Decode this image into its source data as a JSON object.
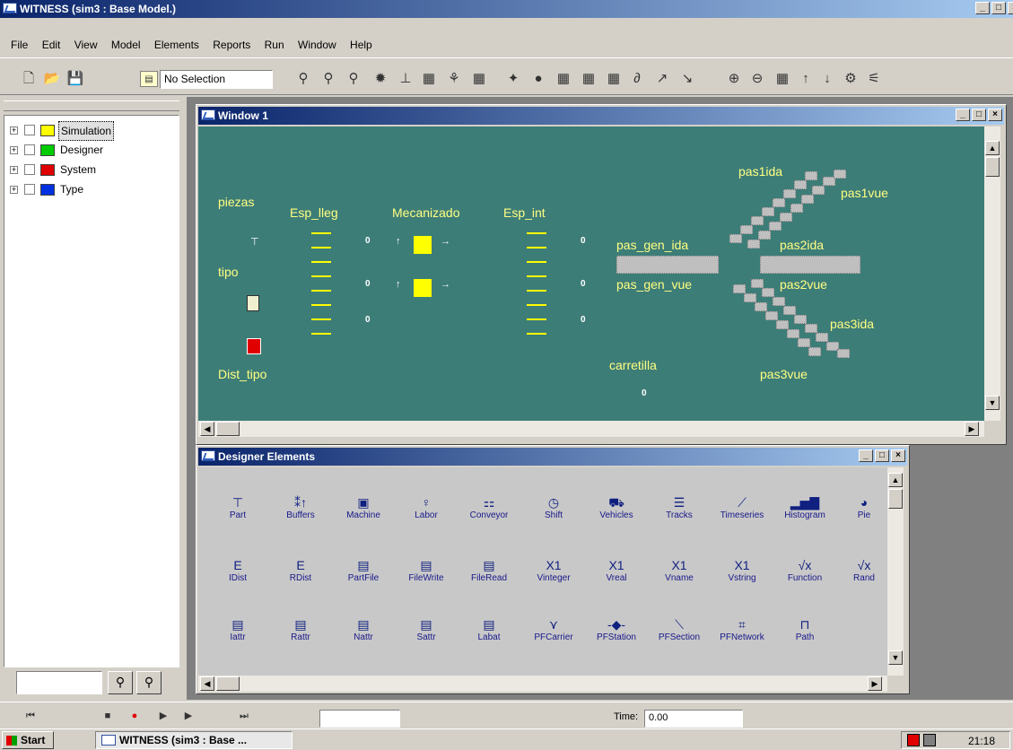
{
  "app": {
    "title": "WITNESS (sim3 : Base Model.)"
  },
  "menu": [
    "File",
    "Edit",
    "View",
    "Model",
    "Elements",
    "Reports",
    "Run",
    "Window",
    "Help"
  ],
  "toolbar": {
    "selection": "No Selection"
  },
  "tree": {
    "items": [
      {
        "label": "Simulation",
        "color": "#ffff00"
      },
      {
        "label": "Designer",
        "color": "#00cc00"
      },
      {
        "label": "System",
        "color": "#e00000"
      },
      {
        "label": "Type",
        "color": "#0030e0"
      }
    ]
  },
  "window1": {
    "title": "Window 1",
    "labels": {
      "piezas": "piezas",
      "tipo": "tipo",
      "dist_tipo": "Dist_tipo",
      "esp_lleg": "Esp_lleg",
      "mecanizado": "Mecanizado",
      "esp_int": "Esp_int",
      "pas1ida": "pas1ida",
      "pas1vue": "pas1vue",
      "pas_gen_ida": "pas_gen_ida",
      "pas2ida": "pas2ida",
      "pas_gen_vue": "pas_gen_vue",
      "pas2vue": "pas2vue",
      "pas3ida": "pas3ida",
      "pas3vue": "pas3vue",
      "carretilla": "carretilla"
    },
    "counts": {
      "esp_lleg": [
        "0",
        "0",
        "0"
      ],
      "esp_int": [
        "0",
        "0",
        "0"
      ],
      "carretilla": "0"
    }
  },
  "designer": {
    "title": "Designer Elements",
    "rows": [
      [
        {
          "label": "Part",
          "icon": "part-icon",
          "glyph": "⊤"
        },
        {
          "label": "Buffers",
          "icon": "buffers-icon",
          "glyph": "⁑↑"
        },
        {
          "label": "Machine",
          "icon": "machine-icon",
          "glyph": "▣"
        },
        {
          "label": "Labor",
          "icon": "labor-icon",
          "glyph": "♀"
        },
        {
          "label": "Conveyor",
          "icon": "conveyor-icon",
          "glyph": "⚏"
        },
        {
          "label": "Shift",
          "icon": "shift-icon",
          "glyph": "◷"
        },
        {
          "label": "Vehicles",
          "icon": "vehicles-icon",
          "glyph": "⛟"
        },
        {
          "label": "Tracks",
          "icon": "tracks-icon",
          "glyph": "☰"
        },
        {
          "label": "Timeseries",
          "icon": "timeseries-icon",
          "glyph": "⟋"
        },
        {
          "label": "Histogram",
          "icon": "histogram-icon",
          "glyph": "▂▅▇"
        },
        {
          "label": "Pie",
          "icon": "pie-icon",
          "glyph": "◕"
        }
      ],
      [
        {
          "label": "IDist",
          "icon": "idist-icon",
          "glyph": "E"
        },
        {
          "label": "RDist",
          "icon": "rdist-icon",
          "glyph": "E"
        },
        {
          "label": "PartFile",
          "icon": "partfile-icon",
          "glyph": "▤"
        },
        {
          "label": "FileWrite",
          "icon": "filewrite-icon",
          "glyph": "▤"
        },
        {
          "label": "FileRead",
          "icon": "fileread-icon",
          "glyph": "▤"
        },
        {
          "label": "Vinteger",
          "icon": "vinteger-icon",
          "glyph": "X1"
        },
        {
          "label": "Vreal",
          "icon": "vreal-icon",
          "glyph": "X1"
        },
        {
          "label": "Vname",
          "icon": "vname-icon",
          "glyph": "X1"
        },
        {
          "label": "Vstring",
          "icon": "vstring-icon",
          "glyph": "X1"
        },
        {
          "label": "Function",
          "icon": "function-icon",
          "glyph": "√x"
        },
        {
          "label": "Rand",
          "icon": "rand-icon",
          "glyph": "√x"
        }
      ],
      [
        {
          "label": "Iattr",
          "icon": "iattr-icon",
          "glyph": "▤"
        },
        {
          "label": "Rattr",
          "icon": "rattr-icon",
          "glyph": "▤"
        },
        {
          "label": "Nattr",
          "icon": "nattr-icon",
          "glyph": "▤"
        },
        {
          "label": "Sattr",
          "icon": "sattr-icon",
          "glyph": "▤"
        },
        {
          "label": "Labat",
          "icon": "labat-icon",
          "glyph": "▤"
        },
        {
          "label": "PFCarrier",
          "icon": "pfcarrier-icon",
          "glyph": "⋎"
        },
        {
          "label": "PFStation",
          "icon": "pfstation-icon",
          "glyph": "-◆-"
        },
        {
          "label": "PFSection",
          "icon": "pfsection-icon",
          "glyph": "⟍"
        },
        {
          "label": "PFNetwork",
          "icon": "pfnetwork-icon",
          "glyph": "⌗"
        },
        {
          "label": "Path",
          "icon": "path-icon",
          "glyph": "⊓"
        }
      ]
    ]
  },
  "runbar": {
    "time_label": "Time:",
    "time_value": "0.00"
  },
  "taskbar": {
    "start": "Start",
    "task": "WITNESS (sim3 : Base ...",
    "clock": "21:18"
  }
}
